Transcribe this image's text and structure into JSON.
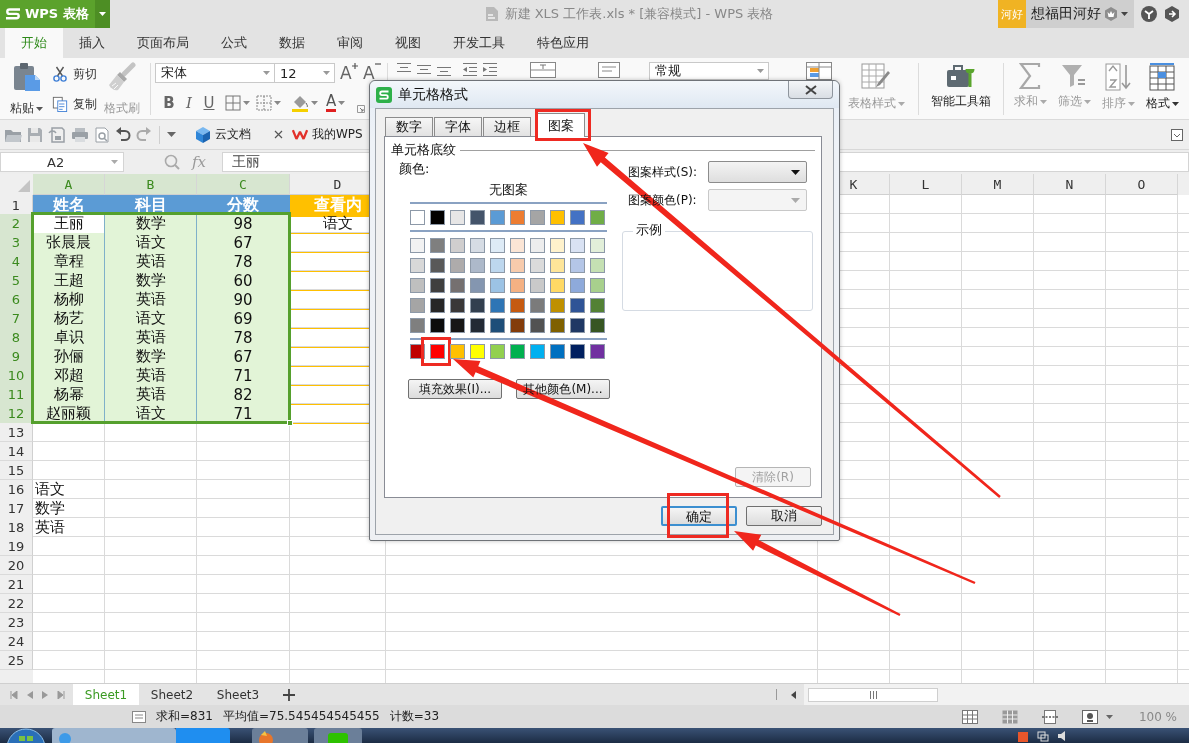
{
  "app_button": {
    "label": "WPS 表格"
  },
  "window": {
    "title": "新建 XLS 工作表.xls * [兼容模式] - WPS 表格"
  },
  "account": {
    "badge": "河好",
    "user": "想福田河好"
  },
  "ribbon_tabs": [
    {
      "label": "开始",
      "selected": true
    },
    {
      "label": "插入",
      "selected": false
    },
    {
      "label": "页面布局",
      "selected": false
    },
    {
      "label": "公式",
      "selected": false
    },
    {
      "label": "数据",
      "selected": false
    },
    {
      "label": "审阅",
      "selected": false
    },
    {
      "label": "视图",
      "selected": false
    },
    {
      "label": "开发工具",
      "selected": false
    },
    {
      "label": "特色应用",
      "selected": false
    }
  ],
  "ribbon": {
    "paste": "粘贴",
    "cut": "剪切",
    "copy": "复制",
    "format_painter": {
      "label": "格式刷",
      "disabled": true
    },
    "font_name": "宋体",
    "font_size": "12",
    "grow_font": "A",
    "shrink_font": "A",
    "bold": "B",
    "italic": "I",
    "underline": "U",
    "font_color": "A",
    "number_format": "常规",
    "tools": [
      {
        "kind": "table-style",
        "label": "表格样式",
        "disabled": true,
        "dropdown": true
      },
      {
        "kind": "toolbox",
        "label": "智能工具箱",
        "disabled": false,
        "dropdown": false
      },
      {
        "kind": "sum",
        "label": "求和",
        "disabled": true,
        "dropdown": true
      },
      {
        "kind": "filter",
        "label": "筛选",
        "disabled": true,
        "dropdown": true
      },
      {
        "kind": "sort",
        "label": "排序",
        "disabled": true,
        "dropdown": true
      },
      {
        "kind": "format",
        "label": "格式",
        "disabled": false,
        "dropdown": true
      }
    ]
  },
  "quick_access": {
    "doc_tabs": [
      {
        "kind": "cloud",
        "label": "云文档"
      },
      {
        "kind": "wps",
        "label": "我的WPS"
      }
    ]
  },
  "formula_bar": {
    "name_box": "A2",
    "function_label": "fx",
    "value": "王丽"
  },
  "sheet": {
    "left_columns": [
      {
        "label": "A",
        "selected": true
      },
      {
        "label": "B",
        "selected": true
      },
      {
        "label": "C",
        "selected": true
      },
      {
        "label": "D",
        "selected": false
      }
    ],
    "right_columns": [
      {
        "label": "K",
        "selected": false
      },
      {
        "label": "L",
        "selected": false
      },
      {
        "label": "M",
        "selected": false
      },
      {
        "label": "N",
        "selected": false
      },
      {
        "label": "O",
        "selected": false
      }
    ],
    "rows": [
      {
        "label": "1",
        "selected": false,
        "cells": [
          {
            "text": "姓名",
            "kind": "header",
            "selected": false,
            "active": false
          },
          {
            "text": "科目",
            "kind": "header",
            "selected": false,
            "active": false
          },
          {
            "text": "分数",
            "kind": "header",
            "selected": false,
            "active": false
          },
          {
            "text": "查看内",
            "kind": "lookup-header",
            "selected": false,
            "active": false
          }
        ]
      },
      {
        "label": "2",
        "selected": true,
        "cells": [
          {
            "text": "王丽",
            "kind": "data",
            "selected": true,
            "active": true
          },
          {
            "text": "数学",
            "kind": "data",
            "selected": true,
            "active": false
          },
          {
            "text": "98",
            "kind": "data",
            "selected": true,
            "active": false
          },
          {
            "text": "语文",
            "kind": "lookup",
            "selected": false,
            "active": false
          }
        ]
      },
      {
        "label": "3",
        "selected": true,
        "cells": [
          {
            "text": "张晨晨",
            "kind": "data",
            "selected": true,
            "active": false
          },
          {
            "text": "语文",
            "kind": "data",
            "selected": true,
            "active": false
          },
          {
            "text": "67",
            "kind": "data",
            "selected": true,
            "active": false
          },
          {
            "kind": "lookup",
            "selected": false,
            "active": false
          }
        ]
      },
      {
        "label": "4",
        "selected": true,
        "cells": [
          {
            "text": "章程",
            "kind": "data",
            "selected": true,
            "active": false
          },
          {
            "text": "英语",
            "kind": "data",
            "selected": true,
            "active": false
          },
          {
            "text": "78",
            "kind": "data",
            "selected": true,
            "active": false
          },
          {
            "kind": "lookup",
            "selected": false,
            "active": false
          }
        ]
      },
      {
        "label": "5",
        "selected": true,
        "cells": [
          {
            "text": "王超",
            "kind": "data",
            "selected": true,
            "active": false
          },
          {
            "text": "数学",
            "kind": "data",
            "selected": true,
            "active": false
          },
          {
            "text": "60",
            "kind": "data",
            "selected": true,
            "active": false
          },
          {
            "kind": "lookup",
            "selected": false,
            "active": false
          }
        ]
      },
      {
        "label": "6",
        "selected": true,
        "cells": [
          {
            "text": "杨柳",
            "kind": "data",
            "selected": true,
            "active": false
          },
          {
            "text": "英语",
            "kind": "data",
            "selected": true,
            "active": false
          },
          {
            "text": "90",
            "kind": "data",
            "selected": true,
            "active": false
          },
          {
            "kind": "lookup",
            "selected": false,
            "active": false
          }
        ]
      },
      {
        "label": "7",
        "selected": true,
        "cells": [
          {
            "text": "杨艺",
            "kind": "data",
            "selected": true,
            "active": false
          },
          {
            "text": "语文",
            "kind": "data",
            "selected": true,
            "active": false
          },
          {
            "text": "69",
            "kind": "data",
            "selected": true,
            "active": false
          },
          {
            "kind": "lookup",
            "selected": false,
            "active": false
          }
        ]
      },
      {
        "label": "8",
        "selected": true,
        "cells": [
          {
            "text": "卓识",
            "kind": "data",
            "selected": true,
            "active": false
          },
          {
            "text": "英语",
            "kind": "data",
            "selected": true,
            "active": false
          },
          {
            "text": "78",
            "kind": "data",
            "selected": true,
            "active": false
          },
          {
            "kind": "lookup",
            "selected": false,
            "active": false
          }
        ]
      },
      {
        "label": "9",
        "selected": true,
        "cells": [
          {
            "text": "孙俪",
            "kind": "data",
            "selected": true,
            "active": false
          },
          {
            "text": "数学",
            "kind": "data",
            "selected": true,
            "active": false
          },
          {
            "text": "67",
            "kind": "data",
            "selected": true,
            "active": false
          },
          {
            "kind": "lookup",
            "selected": false,
            "active": false
          }
        ]
      },
      {
        "label": "10",
        "selected": true,
        "cells": [
          {
            "text": "邓超",
            "kind": "data",
            "selected": true,
            "active": false
          },
          {
            "text": "英语",
            "kind": "data",
            "selected": true,
            "active": false
          },
          {
            "text": "71",
            "kind": "data",
            "selected": true,
            "active": false
          },
          {
            "kind": "lookup",
            "selected": false,
            "active": false
          }
        ]
      },
      {
        "label": "11",
        "selected": true,
        "cells": [
          {
            "text": "杨幂",
            "kind": "data",
            "selected": true,
            "active": false
          },
          {
            "text": "英语",
            "kind": "data",
            "selected": true,
            "active": false
          },
          {
            "text": "82",
            "kind": "data",
            "selected": true,
            "active": false
          },
          {
            "kind": "lookup",
            "selected": false,
            "active": false
          }
        ]
      },
      {
        "label": "12",
        "selected": true,
        "cells": [
          {
            "text": "赵丽颖",
            "kind": "data",
            "selected": true,
            "active": false
          },
          {
            "text": "语文",
            "kind": "data",
            "selected": true,
            "active": false
          },
          {
            "text": "71",
            "kind": "data",
            "selected": true,
            "active": false
          },
          {
            "kind": "lookup",
            "selected": false,
            "active": false
          }
        ]
      },
      {
        "label": "13",
        "selected": false
      },
      {
        "label": "14",
        "selected": false
      },
      {
        "label": "15",
        "selected": false
      },
      {
        "label": "16",
        "selected": false,
        "cells": [
          {
            "text": "语文",
            "kind": "plain",
            "selected": false,
            "active": false
          }
        ]
      },
      {
        "label": "17",
        "selected": false,
        "cells": [
          {
            "text": "数学",
            "kind": "plain",
            "selected": false,
            "active": false
          }
        ]
      },
      {
        "label": "18",
        "selected": false,
        "cells": [
          {
            "text": "英语",
            "kind": "plain",
            "selected": false,
            "active": false
          }
        ]
      },
      {
        "label": "19",
        "selected": false
      },
      {
        "label": "20",
        "selected": false
      },
      {
        "label": "21",
        "selected": false
      },
      {
        "label": "22",
        "selected": false
      },
      {
        "label": "23",
        "selected": false
      },
      {
        "label": "24",
        "selected": false
      },
      {
        "label": "25",
        "selected": false
      }
    ]
  },
  "dialog": {
    "title": "单元格格式",
    "tabs": [
      {
        "label": "数字",
        "selected": false,
        "highlighted": false
      },
      {
        "label": "字体",
        "selected": false,
        "highlighted": false
      },
      {
        "label": "边框",
        "selected": false,
        "highlighted": false
      },
      {
        "label": "图案",
        "selected": true,
        "highlighted": true
      }
    ],
    "group_title": "单元格底纹",
    "color_label": "颜色:",
    "no_color": "无图案",
    "palette": [
      {
        "kind": "theme",
        "swatches": [
          {
            "color": "#ffffff",
            "highlighted": false
          },
          {
            "color": "#000000",
            "highlighted": false
          },
          {
            "color": "#e7e6e6",
            "highlighted": false
          },
          {
            "color": "#44546a",
            "highlighted": false
          },
          {
            "color": "#5b9bd5",
            "highlighted": false
          },
          {
            "color": "#ed7d31",
            "highlighted": false
          },
          {
            "color": "#a5a5a5",
            "highlighted": false
          },
          {
            "color": "#ffc000",
            "highlighted": false
          },
          {
            "color": "#4472c4",
            "highlighted": false
          },
          {
            "color": "#70ad47",
            "highlighted": false
          }
        ]
      },
      {
        "kind": "shade",
        "swatches": [
          {
            "color": "#f2f2f2",
            "highlighted": false
          },
          {
            "color": "#7f7f7f",
            "highlighted": false
          },
          {
            "color": "#d0cece",
            "highlighted": false
          },
          {
            "color": "#d6dce4",
            "highlighted": false
          },
          {
            "color": "#deebf6",
            "highlighted": false
          },
          {
            "color": "#fbe5d5",
            "highlighted": false
          },
          {
            "color": "#ededed",
            "highlighted": false
          },
          {
            "color": "#fff2cc",
            "highlighted": false
          },
          {
            "color": "#d9e2f3",
            "highlighted": false
          },
          {
            "color": "#e2efd9",
            "highlighted": false
          }
        ]
      },
      {
        "kind": "shade",
        "swatches": [
          {
            "color": "#d8d8d8",
            "highlighted": false
          },
          {
            "color": "#595959",
            "highlighted": false
          },
          {
            "color": "#aeabab",
            "highlighted": false
          },
          {
            "color": "#adb9ca",
            "highlighted": false
          },
          {
            "color": "#bdd7ee",
            "highlighted": false
          },
          {
            "color": "#f7cbac",
            "highlighted": false
          },
          {
            "color": "#dbdbdb",
            "highlighted": false
          },
          {
            "color": "#fee599",
            "highlighted": false
          },
          {
            "color": "#b4c6e7",
            "highlighted": false
          },
          {
            "color": "#c5e0b3",
            "highlighted": false
          }
        ]
      },
      {
        "kind": "shade",
        "swatches": [
          {
            "color": "#bfbfbf",
            "highlighted": false
          },
          {
            "color": "#3f3f3f",
            "highlighted": false
          },
          {
            "color": "#757070",
            "highlighted": false
          },
          {
            "color": "#8496b0",
            "highlighted": false
          },
          {
            "color": "#9cc3e5",
            "highlighted": false
          },
          {
            "color": "#f4b183",
            "highlighted": false
          },
          {
            "color": "#c9c9c9",
            "highlighted": false
          },
          {
            "color": "#ffd965",
            "highlighted": false
          },
          {
            "color": "#8eaadb",
            "highlighted": false
          },
          {
            "color": "#a8d08d",
            "highlighted": false
          }
        ]
      },
      {
        "kind": "shade",
        "swatches": [
          {
            "color": "#a5a5a5",
            "highlighted": false
          },
          {
            "color": "#262626",
            "highlighted": false
          },
          {
            "color": "#3a3838",
            "highlighted": false
          },
          {
            "color": "#323f4f",
            "highlighted": false
          },
          {
            "color": "#2e75b5",
            "highlighted": false
          },
          {
            "color": "#c55a11",
            "highlighted": false
          },
          {
            "color": "#7b7b7b",
            "highlighted": false
          },
          {
            "color": "#bf9000",
            "highlighted": false
          },
          {
            "color": "#2f5496",
            "highlighted": false
          },
          {
            "color": "#538135",
            "highlighted": false
          }
        ]
      },
      {
        "kind": "shade",
        "swatches": [
          {
            "color": "#7f7f7f",
            "highlighted": false
          },
          {
            "color": "#0c0c0c",
            "highlighted": false
          },
          {
            "color": "#171616",
            "highlighted": false
          },
          {
            "color": "#222a35",
            "highlighted": false
          },
          {
            "color": "#1e4e79",
            "highlighted": false
          },
          {
            "color": "#833c0b",
            "highlighted": false
          },
          {
            "color": "#525252",
            "highlighted": false
          },
          {
            "color": "#7f6000",
            "highlighted": false
          },
          {
            "color": "#1f3864",
            "highlighted": false
          },
          {
            "color": "#375623",
            "highlighted": false
          }
        ]
      },
      {
        "kind": "standard",
        "swatches": [
          {
            "color": "#c00000",
            "highlighted": false
          },
          {
            "color": "#ff0000",
            "highlighted": true
          },
          {
            "color": "#ffc000",
            "highlighted": false
          },
          {
            "color": "#ffff00",
            "highlighted": false
          },
          {
            "color": "#92d050",
            "highlighted": false
          },
          {
            "color": "#00b050",
            "highlighted": false
          },
          {
            "color": "#00b0f0",
            "highlighted": false
          },
          {
            "color": "#0070c0",
            "highlighted": false
          },
          {
            "color": "#002060",
            "highlighted": false
          },
          {
            "color": "#7030a0",
            "highlighted": false
          }
        ]
      }
    ],
    "buttons": [
      "填充效果(I)...",
      "其他颜色(M)..."
    ],
    "pattern_style": {
      "label": "图案样式(S):",
      "disabled": false
    },
    "pattern_color": {
      "label": "图案颜色(P):",
      "disabled": true
    },
    "sample_label": "示例",
    "clear": {
      "label": "清除(R)",
      "disabled": true
    },
    "ok": {
      "label": "确定",
      "default": true,
      "highlighted": true
    },
    "cancel": {
      "label": "取消",
      "default": false,
      "highlighted": false
    }
  },
  "sheet_tabs": [
    {
      "label": "Sheet1",
      "selected": true
    },
    {
      "label": "Sheet2",
      "selected": false
    },
    {
      "label": "Sheet3",
      "selected": false
    }
  ],
  "status_bar": {
    "stats": [
      "求和=831",
      "平均值=75.545454545455",
      "计数=33"
    ],
    "zoom": "100 %"
  }
}
